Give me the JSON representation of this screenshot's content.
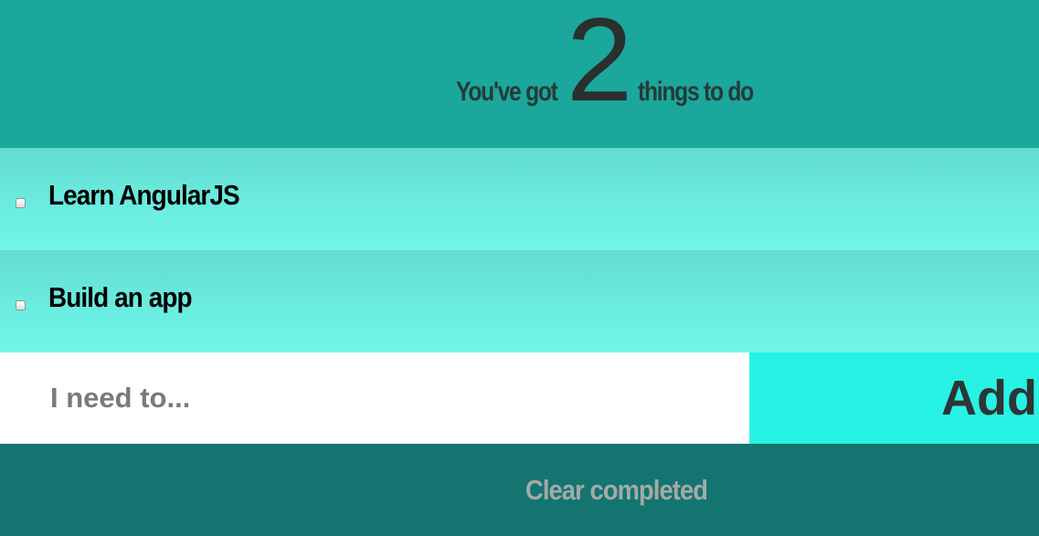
{
  "header": {
    "prefix": "You've got",
    "count": "2",
    "suffix": "things to do"
  },
  "todos": [
    {
      "label": "Learn AngularJS",
      "done": false
    },
    {
      "label": "Build an app",
      "done": false
    }
  ],
  "new_todo": {
    "placeholder": "I need to...",
    "value": ""
  },
  "add_button": {
    "label": "Add"
  },
  "footer": {
    "clear_label": "Clear completed"
  },
  "colors": {
    "header_bg": "#1ba79b",
    "task_bg": "#6bece0",
    "add_bg": "#27f2e4",
    "footer_bg": "#137470"
  }
}
